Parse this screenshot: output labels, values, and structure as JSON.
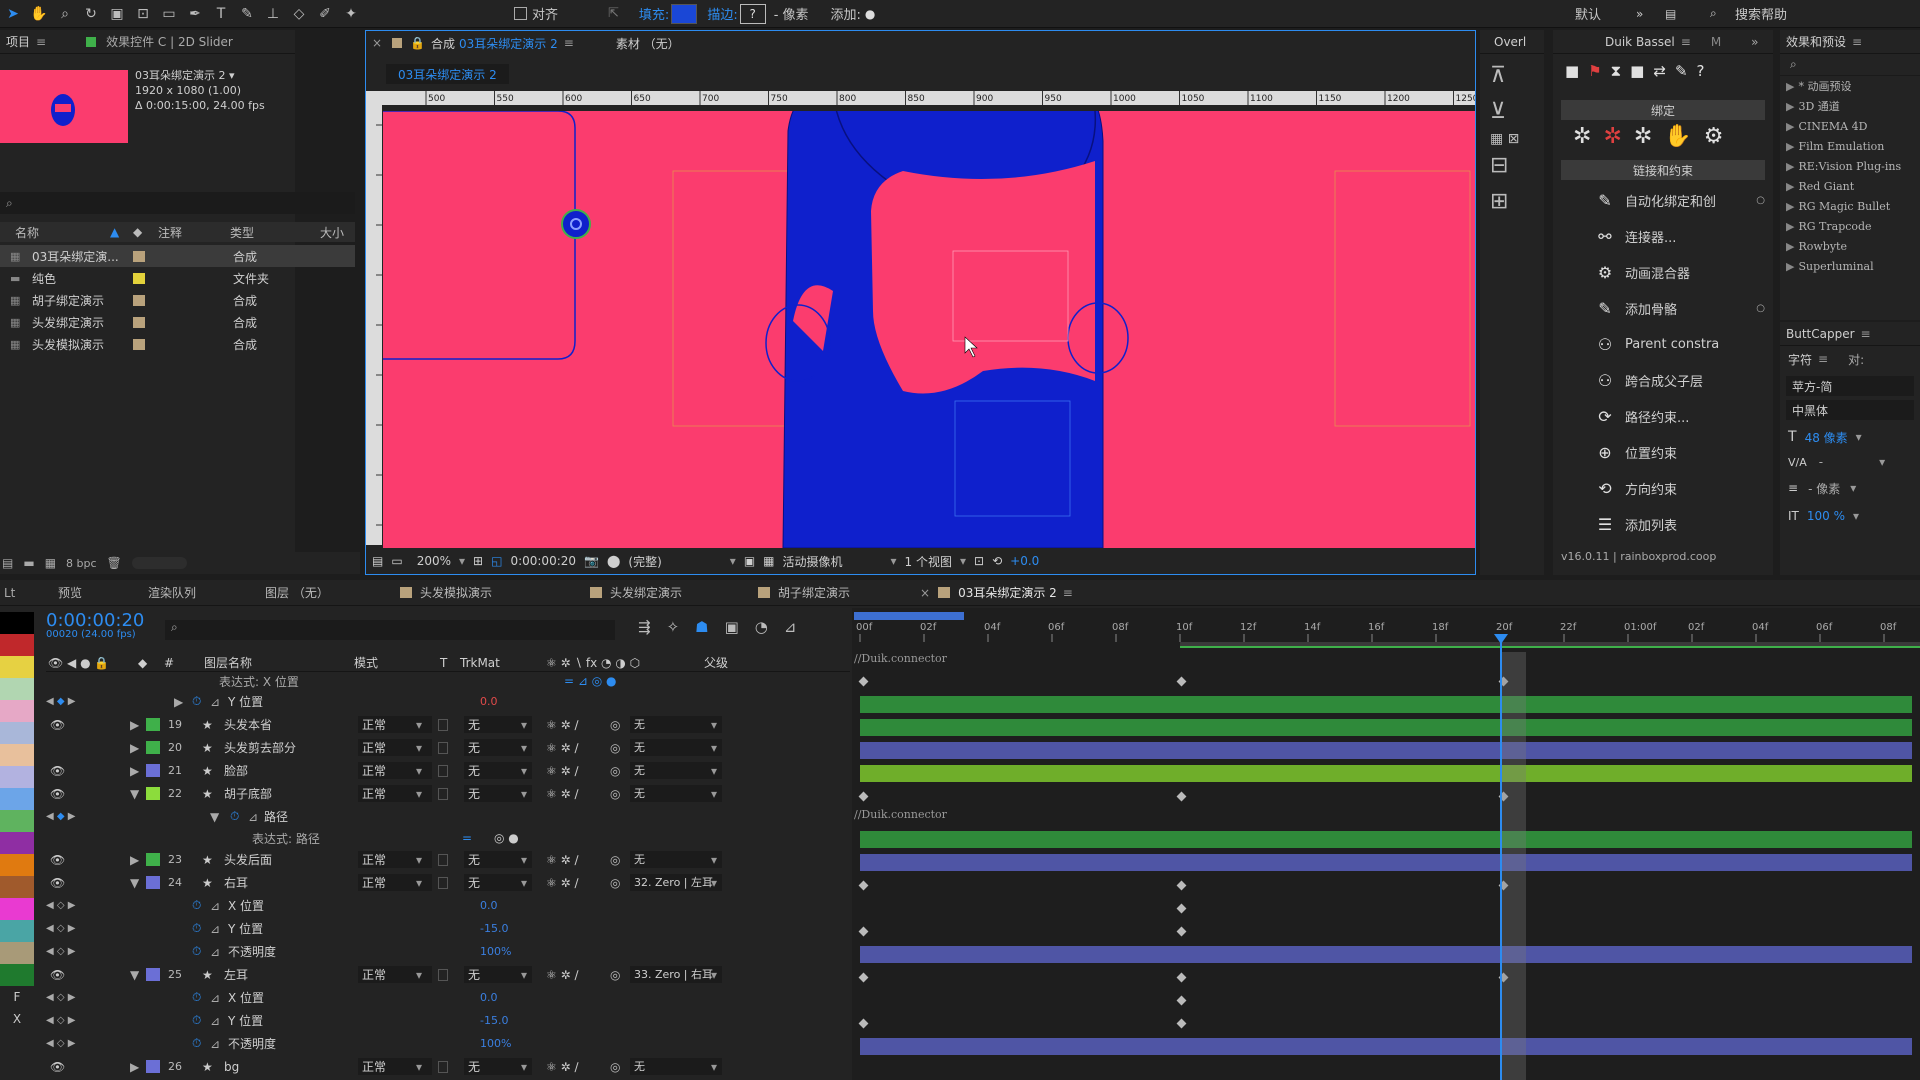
{
  "toolbar": {
    "align_label": "对齐",
    "fill_label": "填充:",
    "stroke_label": "描边:",
    "stroke_value": "?",
    "pixel_label": "- 像素",
    "add_label": "添加:",
    "workspace": "默认",
    "search_help": "搜索帮助",
    "colors": {
      "fill": "#1a47d6"
    }
  },
  "project": {
    "title": "项目",
    "effects_tab": "效果控件 C | 2D Slider",
    "thumb_name": "03耳朵绑定演示 2 ▾",
    "thumb_size": "1920 x 1080 (1.00)",
    "thumb_dur": "Δ 0:00:15:00, 24.00 fps",
    "col_name": "名称",
    "col_note": "注释",
    "col_type": "类型",
    "col_size": "大小",
    "items": [
      {
        "name": "03耳朵绑定演...",
        "type": "合成",
        "color": "#b9a27c"
      },
      {
        "name": "纯色",
        "type": "文件夹",
        "color": "#e3d23b"
      },
      {
        "name": "胡子绑定演示",
        "type": "合成",
        "color": "#b9a27c"
      },
      {
        "name": "头发绑定演示",
        "type": "合成",
        "color": "#b9a27c"
      },
      {
        "name": "头发模拟演示",
        "type": "合成",
        "color": "#b9a27c"
      }
    ],
    "bpc": "8 bpc"
  },
  "comp": {
    "tab": "合成",
    "tab_name": "03耳朵绑定演示 2",
    "footage_tab": "素材 （无）",
    "sub_tab": "03耳朵绑定演示 2",
    "zoom": "200%",
    "timecode": "0:00:00:20",
    "quality": "(完整)",
    "camera": "活动摄像机",
    "views": "1 个视图",
    "exposure": "+0.0",
    "ruler": [
      "500",
      "550",
      "600",
      "650",
      "700",
      "750",
      "800",
      "850",
      "900",
      "950",
      "1000",
      "1050",
      "1100",
      "1150",
      "1200",
      "1250"
    ],
    "colors": {
      "bg": "#fb3c6e",
      "face": "#0f20cc"
    }
  },
  "overlay": {
    "title": "Overl"
  },
  "duik": {
    "title": "Duik Bassel",
    "tab2": "M",
    "sec_bind": "绑定",
    "sec_link": "链接和约束",
    "version": "v16.0.11 | rainboxprod.coop",
    "buttons": [
      "自动化绑定和创",
      "连接器...",
      "动画混合器",
      "添加骨骼",
      "Parent constra",
      "跨合成父子层",
      "路径约束...",
      "位置约束",
      "方向约束",
      "添加列表"
    ],
    "icons": [
      "auto-rig-icon",
      "connector-icon",
      "animation-blender-icon",
      "add-bone-icon",
      "parent-constraint-icon",
      "cross-comp-icon",
      "path-constraint-icon",
      "position-constraint-icon",
      "orientation-constraint-icon",
      "add-list-icon"
    ]
  },
  "effects": {
    "title": "效果和预设",
    "items": [
      "* 动画预设",
      "3D 通道",
      "CINEMA 4D",
      "Film Emulation",
      "RE:Vision Plug-ins",
      "Red Giant",
      "RG Magic Bullet",
      "RG Trapcode",
      "Rowbyte",
      "Superluminal"
    ],
    "buttcapper": "ButtCapper",
    "char_tab": "字符",
    "align_tab": "对:",
    "font": "苹方-简",
    "font_style": "中黑体",
    "font_size": "48 像素",
    "kerning": "-",
    "stroke_w": "- 像素",
    "scale": "100 %"
  },
  "timeline": {
    "tabs": [
      "预览",
      "渲染队列",
      "图层 （无）",
      "头发模拟演示",
      "头发绑定演示",
      "胡子绑定演示",
      "03耳朵绑定演示 2"
    ],
    "tab_colors": [
      "#b9a27c",
      "#b9a27c",
      "#b9a27c",
      "#b9a27c"
    ],
    "timecode": "0:00:00:20",
    "fps": "00020 (24.00 fps)",
    "col_layer": "图层名称",
    "col_mode": "模式",
    "col_t": "T",
    "col_trk": "TrkMat",
    "col_parent": "父级",
    "ticks": [
      "00f",
      "02f",
      "04f",
      "06f",
      "08f",
      "10f",
      "12f",
      "14f",
      "16f",
      "18f",
      "20f",
      "22f",
      "01:00f",
      "02f",
      "04f",
      "06f",
      "08f"
    ],
    "expr_x": "表达式: X 位置",
    "expr_path": "表达式: 路径",
    "connector": "//Duik.connector",
    "rows": [
      {
        "kind": "prop",
        "name": "Y 位置",
        "value": "0.0",
        "valcolor": "#e04a4a"
      },
      {
        "kind": "layer",
        "num": "19",
        "name": "头发本省",
        "mode": "正常",
        "trk": "无",
        "parent": "无",
        "color": "#3fb04a",
        "bar": "#2f8a3a",
        "expand": "▶"
      },
      {
        "kind": "layer",
        "num": "20",
        "name": "头发剪去部分",
        "mode": "正常",
        "trk": "无",
        "parent": "无",
        "color": "#3fb04a",
        "bar": "#2f8a3a",
        "expand": "▶"
      },
      {
        "kind": "layer",
        "num": "21",
        "name": "脸部",
        "mode": "正常",
        "trk": "无",
        "parent": "无",
        "color": "#6b6fd6",
        "bar": "#4f55a5",
        "expand": "▶"
      },
      {
        "kind": "layer",
        "num": "22",
        "name": "胡子底部",
        "mode": "正常",
        "trk": "无",
        "parent": "无",
        "color": "#8cdc3c",
        "bar": "#6fae2a",
        "expand": "▼"
      },
      {
        "kind": "prop",
        "name": "路径",
        "value": ""
      },
      {
        "kind": "layer",
        "num": "23",
        "name": "头发后面",
        "mode": "正常",
        "trk": "无",
        "parent": "无",
        "color": "#3fb04a",
        "bar": "#2f8a3a",
        "expand": "▶"
      },
      {
        "kind": "layer",
        "num": "24",
        "name": "右耳",
        "mode": "正常",
        "trk": "无",
        "parent": "32. Zero | 左耳",
        "color": "#6b6fd6",
        "bar": "#4f55a5",
        "expand": "▼"
      },
      {
        "kind": "prop",
        "name": "X 位置",
        "value": "0.0",
        "valcolor": "#3a7fe0"
      },
      {
        "kind": "prop",
        "name": "Y 位置",
        "value": "-15.0",
        "valcolor": "#3a7fe0"
      },
      {
        "kind": "prop",
        "name": "不透明度",
        "value": "100%",
        "valcolor": "#3a7fe0"
      },
      {
        "kind": "layer",
        "num": "25",
        "name": "左耳",
        "mode": "正常",
        "trk": "无",
        "parent": "33. Zero | 右耳",
        "color": "#6b6fd6",
        "bar": "#4f55a5",
        "expand": "▼"
      },
      {
        "kind": "prop",
        "name": "X 位置",
        "value": "0.0",
        "valcolor": "#3a7fe0"
      },
      {
        "kind": "prop",
        "name": "Y 位置",
        "value": "-15.0",
        "valcolor": "#3a7fe0"
      },
      {
        "kind": "prop",
        "name": "不透明度",
        "value": "100%",
        "valcolor": "#3a7fe0"
      },
      {
        "kind": "layer",
        "num": "26",
        "name": "bg",
        "mode": "正常",
        "trk": "无",
        "parent": "无",
        "color": "#6b6fd6",
        "bar": "#4f55a5",
        "expand": "▶"
      }
    ],
    "left_labels": [
      "F",
      "X"
    ],
    "strip_colors": [
      "#000000",
      "#c0282b",
      "#e6d142",
      "#b1d6b1",
      "#e6a8c6",
      "#a9b7d9",
      "#e8c09c",
      "#b2b2e0",
      "#6ca5e8",
      "#5fb35f",
      "#8f2ea3",
      "#e07a10",
      "#a05a2c",
      "#e93ad1",
      "#4aa5a5",
      "#a89a78",
      "#1f7a2e"
    ]
  }
}
